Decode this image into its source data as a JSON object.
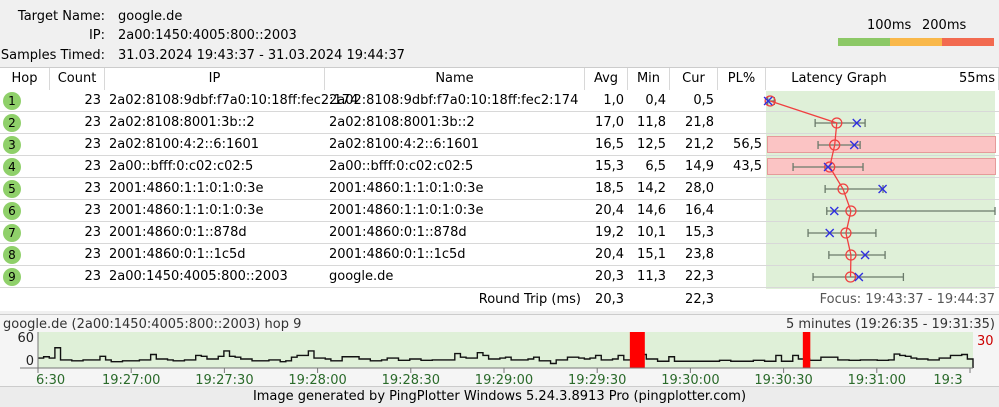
{
  "header": {
    "target_label": "Target Name:",
    "target": "google.de",
    "ip_label": "IP:",
    "ip": "2a00:1450:4005:800::2003",
    "samples_label": "Samples Timed:",
    "samples": "31.03.2024 19:43:37 - 31.03.2024 19:44:37",
    "legend": {
      "t1": "100ms",
      "t2": "200ms",
      "colors": [
        "#8cc866",
        "#f9b84a",
        "#f26a50"
      ]
    }
  },
  "columns": [
    "Hop",
    "Count",
    "IP",
    "Name",
    "Avg",
    "Min",
    "Cur",
    "PL%",
    "Latency Graph"
  ],
  "graph_scale": "55ms",
  "graph_max_ms": 55,
  "hops": [
    {
      "hop": "1",
      "count": "23",
      "ip": "2a02:8108:9dbf:f7a0:10:18ff:fec2:174",
      "name": "2a02:8108:9dbf:f7a0:10:18ff:fec2:174",
      "avg": "1,0",
      "min": "0,4",
      "cur": "0,5",
      "pl": "",
      "avg_ms": 1.0,
      "min_ms": 0.4,
      "max_ms": 2.0,
      "cur_ms": 0.5
    },
    {
      "hop": "2",
      "count": "23",
      "ip": "2a02:8108:8001:3b::2",
      "name": "2a02:8108:8001:3b::2",
      "avg": "17,0",
      "min": "11,8",
      "cur": "21,8",
      "pl": "",
      "avg_ms": 17.0,
      "min_ms": 11.8,
      "max_ms": 23.8,
      "cur_ms": 21.8
    },
    {
      "hop": "3",
      "count": "23",
      "ip": "2a02:8100:4:2::6:1601",
      "name": "2a02:8100:4:2::6:1601",
      "avg": "16,5",
      "min": "12,5",
      "cur": "21,2",
      "pl": "56,5",
      "avg_ms": 16.5,
      "min_ms": 12.5,
      "max_ms": 22.6,
      "cur_ms": 21.2
    },
    {
      "hop": "4",
      "count": "23",
      "ip": "2a00::bfff:0:c02:c02:5",
      "name": "2a00::bfff:0:c02:c02:5",
      "avg": "15,3",
      "min": "6,5",
      "cur": "14,9",
      "pl": "43,5",
      "avg_ms": 15.3,
      "min_ms": 6.5,
      "max_ms": 23.3,
      "cur_ms": 14.9
    },
    {
      "hop": "5",
      "count": "23",
      "ip": "2001:4860:1:1:0:1:0:3e",
      "name": "2001:4860:1:1:0:1:0:3e",
      "avg": "18,5",
      "min": "14,2",
      "cur": "28,0",
      "pl": "",
      "avg_ms": 18.5,
      "min_ms": 14.2,
      "max_ms": 28.1,
      "cur_ms": 28.0
    },
    {
      "hop": "6",
      "count": "23",
      "ip": "2001:4860:1:1:0:1:0:3e",
      "name": "2001:4860:1:1:0:1:0:3e",
      "avg": "20,4",
      "min": "14,6",
      "cur": "16,4",
      "pl": "",
      "avg_ms": 20.4,
      "min_ms": 14.6,
      "max_ms": 55.0,
      "cur_ms": 16.4
    },
    {
      "hop": "7",
      "count": "23",
      "ip": "2001:4860:0:1::878d",
      "name": "2001:4860:0:1::878d",
      "avg": "19,2",
      "min": "10,1",
      "cur": "15,3",
      "pl": "",
      "avg_ms": 19.2,
      "min_ms": 10.1,
      "max_ms": 26.4,
      "cur_ms": 15.3
    },
    {
      "hop": "8",
      "count": "23",
      "ip": "2001:4860:0:1::1c5d",
      "name": "2001:4860:0:1::1c5d",
      "avg": "20,4",
      "min": "15,1",
      "cur": "23,8",
      "pl": "",
      "avg_ms": 20.4,
      "min_ms": 15.1,
      "max_ms": 28.6,
      "cur_ms": 23.8
    },
    {
      "hop": "9",
      "count": "23",
      "ip": "2a00:1450:4005:800::2003",
      "name": "google.de",
      "avg": "20,3",
      "min": "11,3",
      "cur": "22,3",
      "pl": "",
      "avg_ms": 20.3,
      "min_ms": 11.3,
      "max_ms": 33.0,
      "cur_ms": 22.3
    }
  ],
  "round_trip": {
    "label": "Round Trip (ms)",
    "avg": "20,3",
    "cur": "22,3",
    "focus": "Focus: 19:43:37 - 19:44:37"
  },
  "chart_data": {
    "type": "line",
    "title": "google.de (2a00:1450:4005:800::2003) hop 9",
    "range_label": "5 minutes (19:26:35 - 19:31:35)",
    "y_ticks": [
      "60",
      "0"
    ],
    "ylim": [
      0,
      80
    ],
    "scale_label": "30",
    "x_ticks": [
      "6:30",
      "19:27:00",
      "19:27:30",
      "19:28:00",
      "19:28:30",
      "19:29:00",
      "19:29:30",
      "19:30:00",
      "19:30:30",
      "19:31:00",
      "19:3"
    ],
    "values": [
      22,
      25,
      22,
      45,
      18,
      18,
      16,
      16,
      18,
      18,
      18,
      26,
      18,
      14,
      14,
      16,
      16,
      16,
      18,
      18,
      30,
      20,
      20,
      18,
      16,
      16,
      18,
      18,
      28,
      26,
      20,
      20,
      26,
      38,
      26,
      24,
      20,
      20,
      16,
      16,
      16,
      18,
      18,
      14,
      16,
      24,
      28,
      28,
      38,
      22,
      22,
      20,
      16,
      16,
      25,
      25,
      25,
      20,
      20,
      16,
      16,
      18,
      22,
      22,
      17,
      17,
      20,
      20,
      17,
      17,
      18,
      18,
      18,
      18,
      32,
      24,
      22,
      22,
      34,
      28,
      20,
      20,
      22,
      24,
      18,
      18,
      18,
      20,
      24,
      16,
      16,
      10,
      18,
      18,
      24,
      24,
      22,
      20,
      22,
      28,
      18,
      18,
      20,
      28,
      18,
      18,
      15,
      30,
      20,
      20,
      15,
      15,
      25,
      15,
      15,
      15,
      15,
      15,
      15,
      15,
      15,
      17,
      17,
      15,
      15,
      15,
      15,
      17,
      17,
      15,
      15,
      28,
      15,
      15,
      28,
      20,
      20,
      17,
      17,
      24,
      24,
      24,
      18,
      18,
      17,
      17,
      18,
      18,
      18,
      17,
      17,
      18,
      31,
      28,
      26,
      22,
      20,
      20,
      18,
      18,
      22,
      22,
      28,
      28,
      30,
      20
    ],
    "loss_marks": [
      {
        "at": 0.633,
        "span": 0.016
      },
      {
        "at": 0.818,
        "span": 0.008
      }
    ]
  },
  "footer": "Image generated by PingPlotter Windows 5.24.3.8913 Pro (pingplotter.com)"
}
